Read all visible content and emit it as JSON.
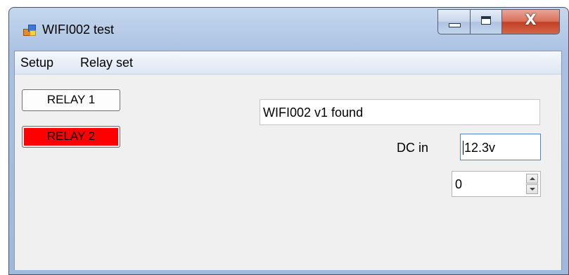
{
  "window": {
    "title": "WIFI002 test",
    "icon": "windows-forms-app-icon",
    "caption_buttons": {
      "minimize_icon": "minimize-icon",
      "maximize_icon": "maximize-icon",
      "close_glyph": "X"
    }
  },
  "menu": {
    "items": [
      {
        "label": "Setup"
      },
      {
        "label": "Relay set"
      }
    ]
  },
  "relays": {
    "relay1": {
      "label": "RELAY 1",
      "color": "#fdfdfd"
    },
    "relay2": {
      "label": "RELAY 2",
      "color": "#ff0000"
    }
  },
  "status": {
    "text": "WIFI002 v1 found"
  },
  "dc_in": {
    "label": "DC in",
    "value": "12.3v"
  },
  "numeric": {
    "value": "0"
  }
}
